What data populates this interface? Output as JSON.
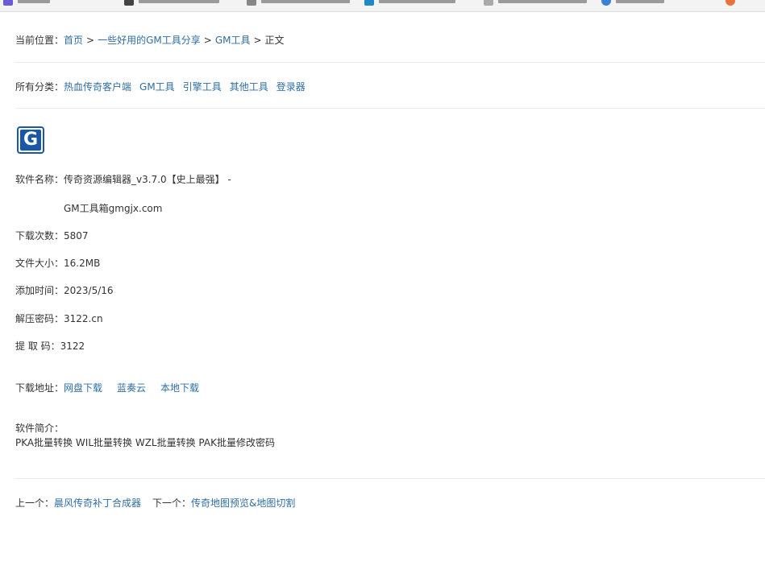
{
  "breadcrumb": {
    "label": "当前位置：",
    "items": [
      "首页",
      "一些好用的GM工具分享",
      "GM工具"
    ],
    "current": "正文",
    "separator": ">"
  },
  "categories": {
    "label": "所有分类：",
    "items": [
      "热血传奇客户端",
      "GM工具",
      "引擎工具",
      "其他工具",
      "登录器"
    ]
  },
  "logo": {
    "letter": "G",
    "icon": "gm-logo-icon",
    "color": "#1a57a8"
  },
  "software": {
    "name_label": "软件名称：",
    "name_value": "传奇资源编辑器_v3.7.0【史上最强】 -",
    "name_value_line2": "GM工具箱gmgjx.com",
    "downloads_label": "下载次数：",
    "downloads_value": "5807",
    "size_label": "文件大小：",
    "size_value": "16.2MB",
    "date_label": "添加时间：",
    "date_value": "2023/5/16",
    "password_label": "解压密码：",
    "password_value": "3122.cn",
    "code_label": "提 取 码：",
    "code_value": "3122"
  },
  "download": {
    "label": "下载地址：",
    "links": [
      "网盘下载",
      "蓝奏云",
      "本地下载"
    ]
  },
  "intro": {
    "label": "软件简介：",
    "text": "PKA批量转换 WIL批量转换 WZL批量转换 PAK批量修改密码"
  },
  "nav": {
    "prev_label": "上一个：",
    "prev_link": "晨风传奇补丁合成器",
    "next_label": "下一个：",
    "next_link": "传奇地图预览&地图切割"
  },
  "colors": {
    "link": "#2f6ea3",
    "text": "#333333",
    "divider": "#ebebeb"
  }
}
